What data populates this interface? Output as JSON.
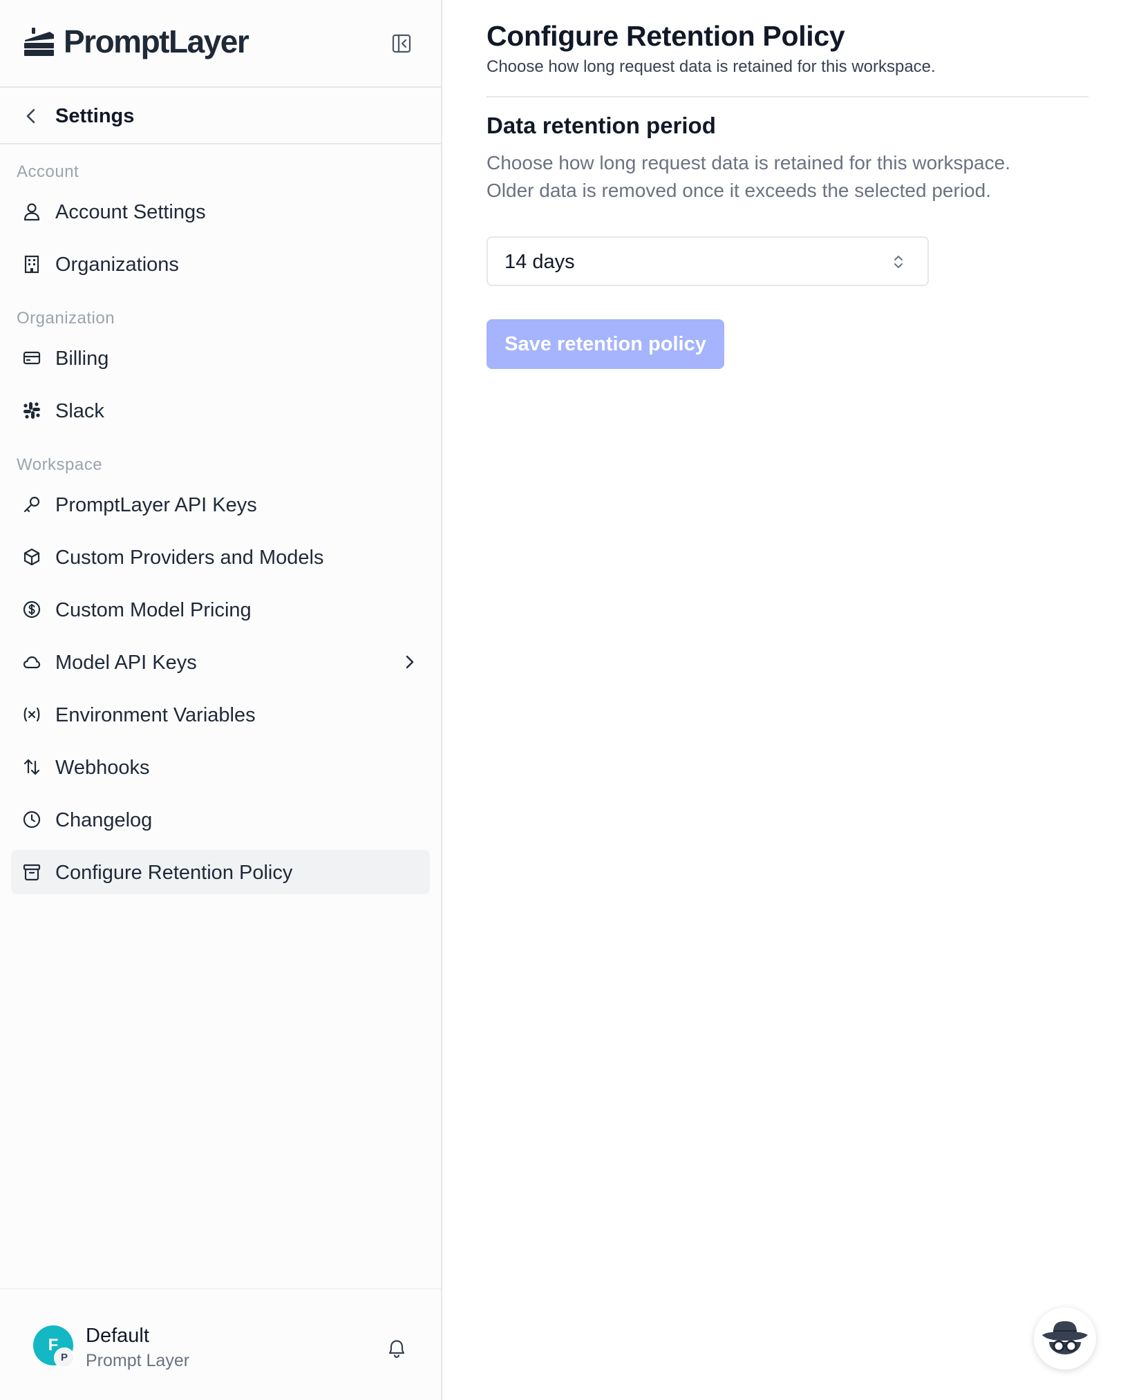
{
  "brand": {
    "name": "PromptLayer",
    "logo_icon": "layered-cake-icon"
  },
  "sidebar": {
    "header": {
      "title": "Settings"
    },
    "sections": [
      {
        "label": "Account"
      },
      {
        "label": "Organization"
      },
      {
        "label": "Workspace"
      }
    ],
    "items": [
      {
        "label": "Account Settings",
        "icon": "user-icon"
      },
      {
        "label": "Organizations",
        "icon": "building-icon"
      },
      {
        "label": "Billing",
        "icon": "credit-card-icon"
      },
      {
        "label": "Slack",
        "icon": "slack-icon"
      },
      {
        "label": "PromptLayer API Keys",
        "icon": "key-icon"
      },
      {
        "label": "Custom Providers and Models",
        "icon": "box-icon"
      },
      {
        "label": "Custom Model Pricing",
        "icon": "dollar-circle-icon"
      },
      {
        "label": "Model API Keys",
        "icon": "cloud-icon",
        "has_submenu": true
      },
      {
        "label": "Environment Variables",
        "icon": "variable-icon"
      },
      {
        "label": "Webhooks",
        "icon": "arrows-up-down-icon"
      },
      {
        "label": "Changelog",
        "icon": "clock-icon"
      },
      {
        "label": "Configure Retention Policy",
        "icon": "archive-icon",
        "active": true
      }
    ],
    "footer": {
      "avatar_initial": "F",
      "avatar_badge": "P",
      "workspace_name": "Default",
      "organization_name": "Prompt Layer",
      "avatar_color": "#14b8c4"
    }
  },
  "main": {
    "title": "Configure Retention Policy",
    "subtitle": "Choose how long request data is retained for this workspace.",
    "section": {
      "title": "Data retention period",
      "description_line1": "Choose how long request data is retained for this workspace.",
      "description_line2": "Older data is removed once it exceeds the selected period."
    },
    "retention_select": {
      "value": "14 days"
    },
    "save_button": {
      "label": "Save retention policy",
      "disabled": true,
      "color": "#a5b4fc"
    }
  }
}
